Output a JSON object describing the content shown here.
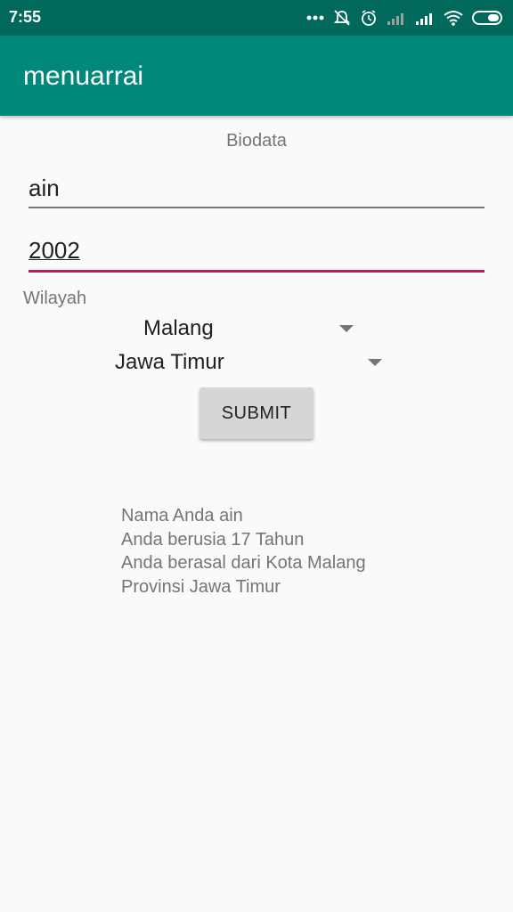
{
  "status_bar": {
    "time": "7:55",
    "icons": [
      "more-dots-icon",
      "bell-off-icon",
      "alarm-icon",
      "signal-weak-icon",
      "signal-icon",
      "wifi-icon",
      "battery-icon"
    ]
  },
  "app_bar": {
    "title": "menuarrai"
  },
  "form": {
    "heading": "Biodata",
    "name_value": "ain",
    "year_value": "2002",
    "region_label": "Wilayah",
    "city_selected": "Malang",
    "province_selected": "Jawa Timur",
    "submit_label": "SUBMIT"
  },
  "result": {
    "lines": [
      "Nama Anda ain",
      "Anda berusia 17 Tahun",
      "Anda berasal dari Kota Malang",
      "Provinsi Jawa Timur"
    ]
  },
  "colors": {
    "status_bar": "#00695c",
    "app_bar": "#00897b",
    "accent": "#c2185b"
  }
}
